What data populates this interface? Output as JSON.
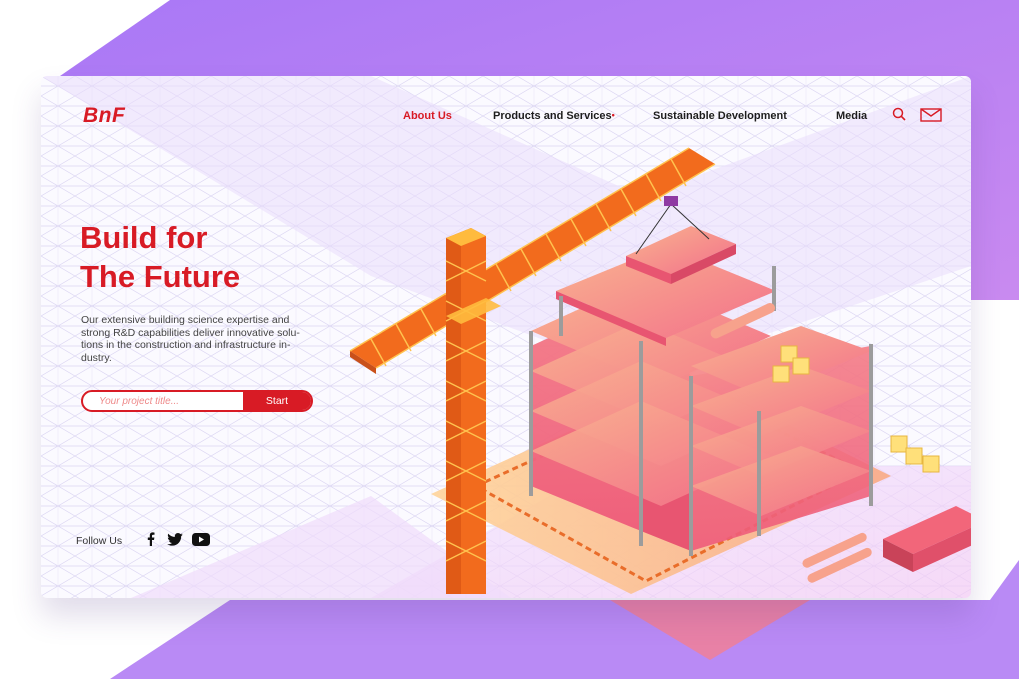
{
  "brand": {
    "logo": "BnF"
  },
  "nav": {
    "items": [
      {
        "label": "About Us",
        "active": true
      },
      {
        "label": "Products and Services",
        "has_dot": true
      },
      {
        "label": "Sustainable Development"
      },
      {
        "label": "Media"
      }
    ],
    "dot": "•"
  },
  "hero": {
    "title_line1": "Build for",
    "title_line2": "The Future",
    "description": "Our extensive building science expertise and strong R&D capabilities deliver innovative solu- tions in the construction and infrastructure in- dustry."
  },
  "form": {
    "placeholder": "Your project title...",
    "button_label": "Start"
  },
  "footer": {
    "follow_label": "Follow Us"
  },
  "icons": [
    "search-icon",
    "mail-icon",
    "facebook-icon",
    "twitter-icon",
    "youtube-icon"
  ],
  "colors": {
    "brand_red": "#d81b25",
    "purple": "#a77ef5",
    "crane_orange": "#f26b1d",
    "building_pink": "#f2667a"
  }
}
